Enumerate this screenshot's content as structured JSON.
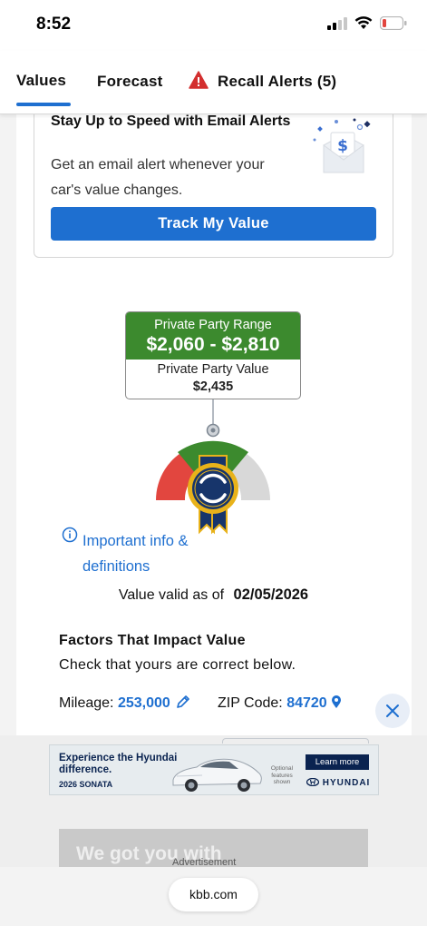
{
  "status": {
    "time": "8:52",
    "icons": [
      "cellular-signal-icon",
      "wifi-icon",
      "battery-low-icon"
    ]
  },
  "tabs": [
    {
      "label": "Values",
      "active": true
    },
    {
      "label": "Forecast",
      "active": false
    },
    {
      "label": "Recall Alerts (5)",
      "active": false,
      "icon": "warning-icon"
    }
  ],
  "email_alert": {
    "title": "Stay Up to Speed with Email Alerts",
    "description": "Get an email alert whenever your car's value changes.",
    "button_label": "Track My Value",
    "illustration": "email-dollar-illustration-icon"
  },
  "valuation": {
    "range_label": "Private Party Range",
    "range_value": "$2,060 - $2,810",
    "value_label": "Private Party Value",
    "value": "$2,435"
  },
  "info": {
    "link_text": "Important info & definitions",
    "icon": "info-icon"
  },
  "valid": {
    "label": "Value valid as of",
    "date": "02/05/2026"
  },
  "factors": {
    "title": "Factors That Impact Value",
    "subtitle": "Check that yours are correct below.",
    "mileage_label": "Mileage:",
    "mileage_value": "253,000",
    "zip_label": "ZIP Code:",
    "zip_value": "84720"
  },
  "ad": {
    "headline": "Experience the Hyundai difference.",
    "model": "2026 SONATA",
    "optional_note": "Optional features shown",
    "cta": "Learn more",
    "brand": "HYUNDAI",
    "secondary_text": "We got you with",
    "advertisement_label": "Advertisement"
  },
  "browser": {
    "url": "kbb.com"
  },
  "colors": {
    "accent_blue": "#1e6fd0",
    "range_green": "#3c8a2e",
    "gauge_red": "#e2463f",
    "gauge_green": "#3c8a2e",
    "gauge_grey": "#d8d8d8",
    "badge_navy": "#17356b",
    "badge_gold": "#e8b21a"
  }
}
